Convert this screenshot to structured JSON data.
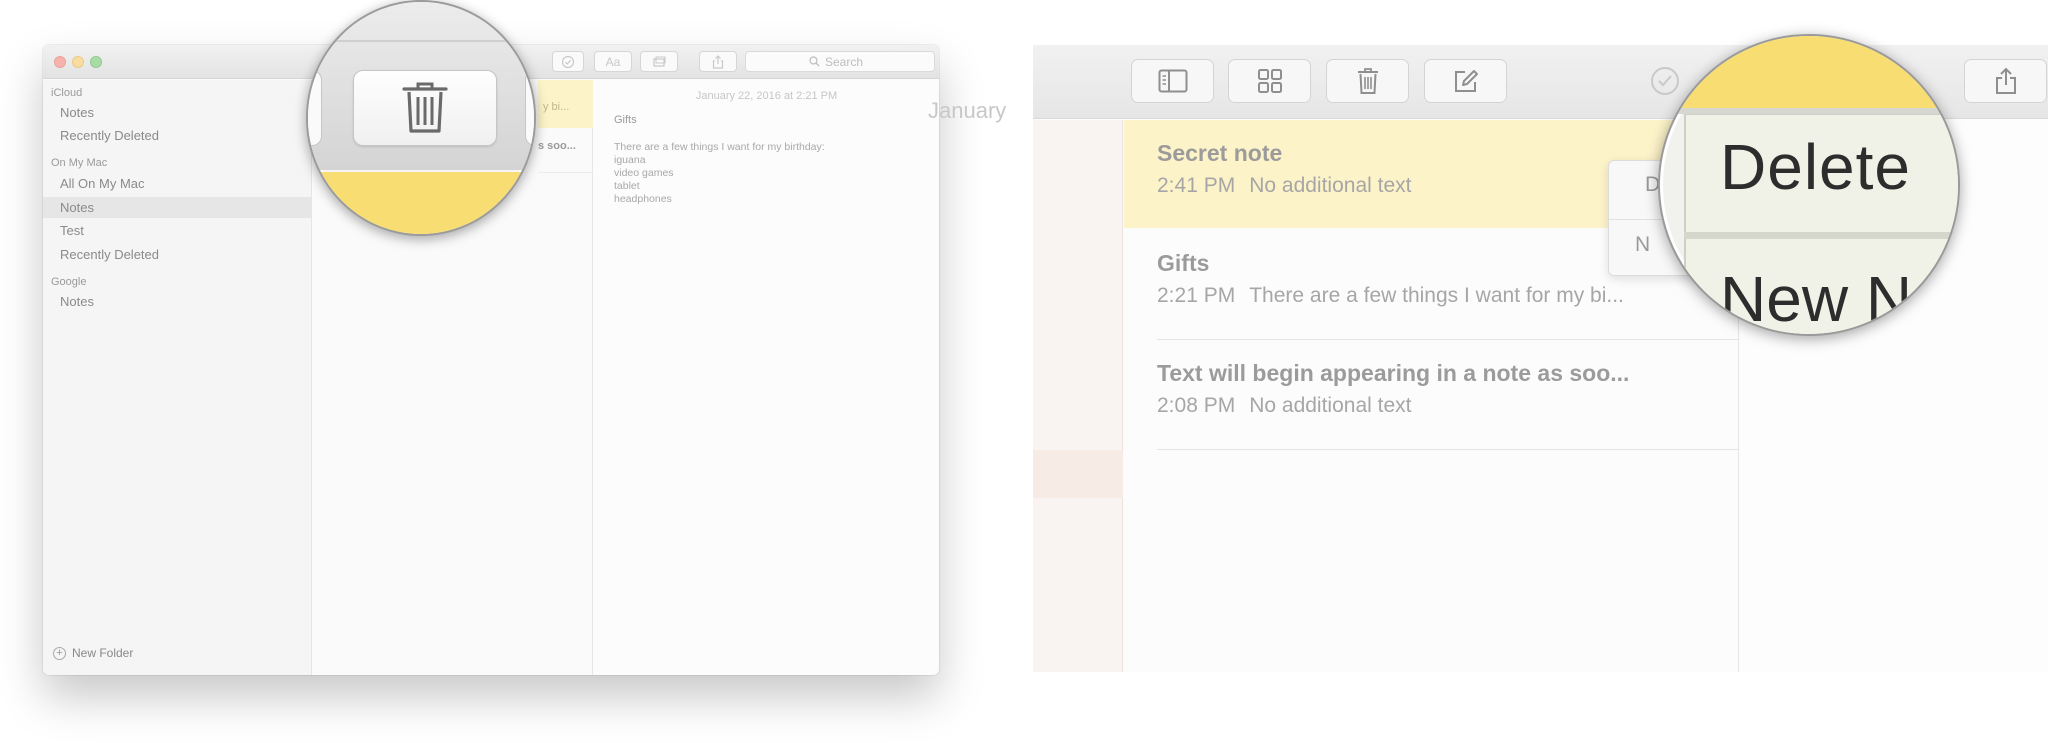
{
  "window": {
    "search_placeholder": "Search",
    "format_button_label": "Aa",
    "sidebar": {
      "sections": [
        {
          "title": "iCloud",
          "items": [
            "Notes",
            "Recently Deleted"
          ]
        },
        {
          "title": "On My Mac",
          "items": [
            "All On My Mac",
            "Notes",
            "Test",
            "Recently Deleted"
          ]
        },
        {
          "title": "Google",
          "items": [
            "Notes"
          ]
        }
      ],
      "selected_item": "Notes",
      "new_folder_label": "New Folder"
    },
    "note_list_partial": {
      "selected_snippet": "y bi...",
      "second_snippet": "s soo..."
    },
    "editor": {
      "date": "January 22, 2016 at 2:21 PM",
      "title": "Gifts",
      "intro": "There are a few things I want for my birthday:",
      "items": [
        "iguana",
        "video games",
        "tablet",
        "headphones"
      ]
    }
  },
  "zoom": {
    "notes": [
      {
        "title": "Secret note",
        "time": "2:41 PM",
        "preview": "No additional text",
        "selected": true
      },
      {
        "title": "Gifts",
        "time": "2:21 PM",
        "preview": "There are a few things I want for my bi..."
      },
      {
        "title": "Text will begin appearing in a note as soo...",
        "time": "2:08 PM",
        "preview": "No additional text"
      }
    ],
    "date_partial": "January",
    "context_menu_partial": {
      "item1": "D",
      "item2": "N"
    },
    "magnified_menu": {
      "delete_label": "Delete",
      "new_label": "New N"
    }
  },
  "colors": {
    "selection_yellow": "#fdf3c9",
    "magnified_yellow": "#f8dd73",
    "sidebar_selected": "#e6e6e6"
  },
  "icons": [
    "trash-icon",
    "sidebar-toggle-icon",
    "gallery-icon",
    "compose-icon",
    "checklist-icon",
    "share-icon",
    "attachment-icon",
    "search-icon"
  ]
}
